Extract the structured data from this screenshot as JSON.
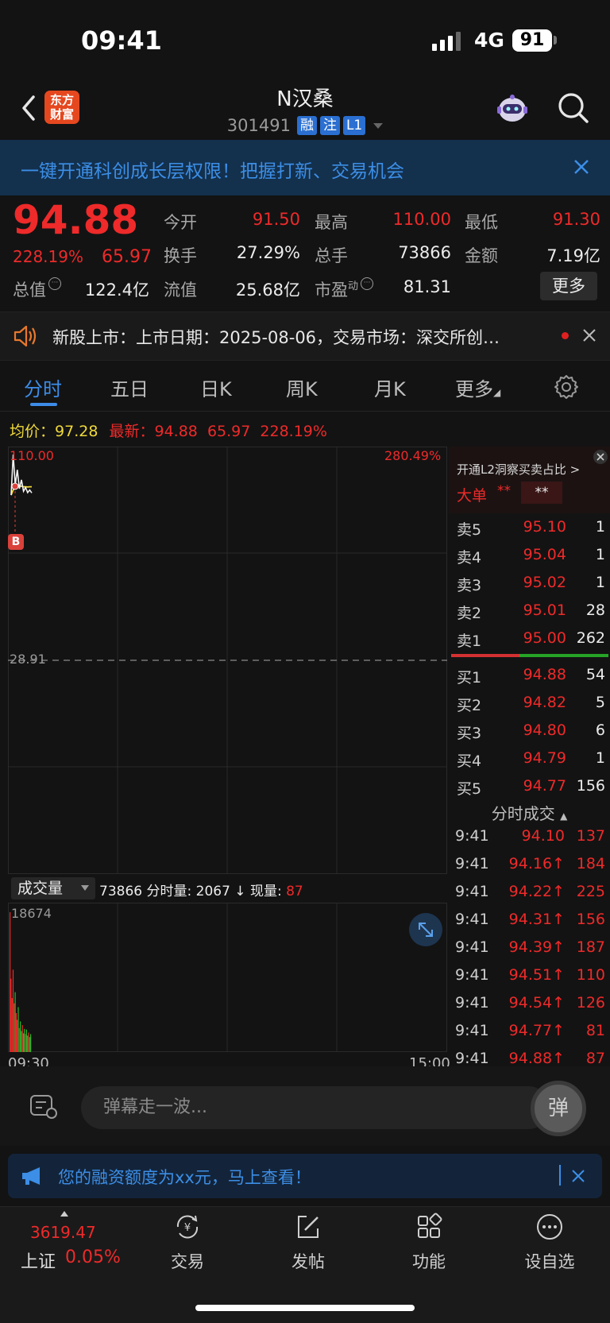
{
  "status_bar": {
    "time": "09:41",
    "network": "4G",
    "battery": "91"
  },
  "header": {
    "logo_text_1": "东方",
    "logo_text_2": "财富",
    "stock_name": "N汉桑",
    "stock_code": "301491",
    "tags": [
      "融",
      "注",
      "L1"
    ]
  },
  "banner": {
    "text": "一键开通科创成长层权限！把握打新、交易机会"
  },
  "quote": {
    "price": "94.88",
    "change_pct": "228.19%",
    "change": "65.97",
    "fields": [
      {
        "label": "今开",
        "value": "91.50",
        "color": "red"
      },
      {
        "label": "最高",
        "value": "110.00",
        "color": "red"
      },
      {
        "label": "最低",
        "value": "91.30",
        "color": "red"
      },
      {
        "label": "换手",
        "value": "27.29%",
        "color": "white"
      },
      {
        "label": "总手",
        "value": "73866",
        "color": "white"
      },
      {
        "label": "金额",
        "value": "7.19亿",
        "color": "white"
      },
      {
        "label": "总值",
        "value": "122.4亿",
        "color": "white"
      },
      {
        "label": "流值",
        "value": "25.68亿",
        "color": "white"
      },
      {
        "label": "市盈",
        "value": "81.31",
        "color": "white"
      }
    ],
    "pe_sup": "动",
    "more_label": "更多"
  },
  "notice": {
    "text": "新股上市：上市日期：2025-08-06，交易市场：深交所创…"
  },
  "tabs": [
    "分时",
    "五日",
    "日K",
    "周K",
    "月K",
    "更多"
  ],
  "avg_line": {
    "avg_label": "均价：",
    "avg_value": "97.28",
    "latest_label": "最新：",
    "latest_value": "94.88",
    "latest_change": "65.97",
    "latest_pct": "228.19%"
  },
  "chart": {
    "max_price": "110.00",
    "max_pct": "280.49%",
    "prev_close": "28.91",
    "marker": "B",
    "time_start": "09:30",
    "time_end": "15:00"
  },
  "chart_data": {
    "type": "line",
    "y_range": [
      -52.18,
      110.0
    ],
    "baseline": 28.91,
    "price_series": [
      94.0,
      110.0,
      98.0,
      104.0,
      96.5,
      100.0,
      95.5,
      97.0,
      95.0,
      96.0,
      94.88
    ],
    "avg_series": [
      94.0,
      96.0,
      97.0,
      97.5,
      97.4,
      97.5,
      97.3,
      97.3,
      97.2,
      97.3,
      97.28
    ],
    "volume": [
      18674,
      9800,
      7200,
      11000,
      6500,
      8000,
      5200,
      4300,
      6000,
      3200,
      4100,
      2800,
      3600,
      2500,
      3100,
      2400,
      3000,
      2200,
      2600,
      2000,
      2400
    ],
    "volume_colors": [
      "r",
      "r",
      "r",
      "r",
      "r",
      "g",
      "r",
      "r",
      "g",
      "r",
      "g",
      "g",
      "r",
      "g",
      "g",
      "r",
      "g",
      "g",
      "r",
      "g",
      "g"
    ]
  },
  "volume": {
    "selector": "成交量",
    "info_total": "73866",
    "info_label_1": " 分时量: ",
    "info_period": "2067",
    "info_arrow": " ↓ ",
    "info_label_2": "现量: ",
    "info_now": "87",
    "max": "18674"
  },
  "l2": {
    "title": "开通L2洞察买卖占比 >",
    "big_label": "大单",
    "big_v1": "**",
    "big_v2": "**"
  },
  "orderbook": {
    "asks": [
      {
        "label": "卖5",
        "price": "95.10",
        "vol": "1"
      },
      {
        "label": "卖4",
        "price": "95.04",
        "vol": "1"
      },
      {
        "label": "卖3",
        "price": "95.02",
        "vol": "1"
      },
      {
        "label": "卖2",
        "price": "95.01",
        "vol": "28"
      },
      {
        "label": "卖1",
        "price": "95.00",
        "vol": "262"
      }
    ],
    "bids": [
      {
        "label": "买1",
        "price": "94.88",
        "vol": "54"
      },
      {
        "label": "买2",
        "price": "94.82",
        "vol": "5"
      },
      {
        "label": "买3",
        "price": "94.80",
        "vol": "6"
      },
      {
        "label": "买4",
        "price": "94.79",
        "vol": "1"
      },
      {
        "label": "买5",
        "price": "94.77",
        "vol": "156"
      }
    ]
  },
  "ticks": {
    "title": "分时成交",
    "rows": [
      {
        "time": "9:41",
        "price": "94.10",
        "vol": "137"
      },
      {
        "time": "9:41",
        "price": "94.16↑",
        "vol": "184"
      },
      {
        "time": "9:41",
        "price": "94.22↑",
        "vol": "225"
      },
      {
        "time": "9:41",
        "price": "94.31↑",
        "vol": "156"
      },
      {
        "time": "9:41",
        "price": "94.39↑",
        "vol": "187"
      },
      {
        "time": "9:41",
        "price": "94.51↑",
        "vol": "110"
      },
      {
        "time": "9:41",
        "price": "94.54↑",
        "vol": "126"
      },
      {
        "time": "9:41",
        "price": "94.77↑",
        "vol": "81"
      },
      {
        "time": "9:41",
        "price": "94.88↑",
        "vol": "87"
      }
    ]
  },
  "comment": {
    "placeholder": "弹幕走一波...",
    "danmu_label": "弹"
  },
  "promo": {
    "text": "您的融资额度为xx元，马上查看！"
  },
  "index": {
    "value": "3619.47",
    "name": "上证",
    "pct": "0.05%"
  },
  "tabbar": [
    {
      "label": "交易",
      "icon": "yen-exchange-icon"
    },
    {
      "label": "发帖",
      "icon": "edit-post-icon"
    },
    {
      "label": "功能",
      "icon": "grid-icon"
    },
    {
      "label": "设自选",
      "icon": "more-dots-icon"
    }
  ],
  "colors": {
    "up": "#ee2a2a",
    "down": "#2bb62b",
    "accent": "#3d8ce8",
    "avg": "#f0d93a"
  }
}
